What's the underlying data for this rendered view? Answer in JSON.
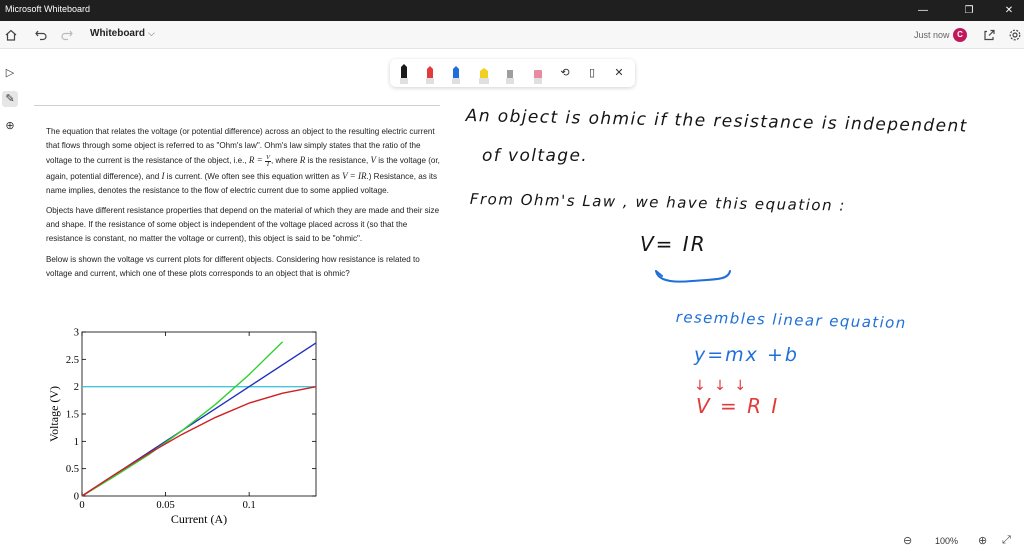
{
  "window": {
    "title": "Microsoft Whiteboard",
    "minimize": "—",
    "restore": "❐",
    "close": "✕"
  },
  "header": {
    "home_icon": "home-icon",
    "undo_icon": "undo-icon",
    "redo_icon": "redo-icon",
    "board_title": "Whiteboard",
    "board_dropdown": "⌵",
    "save_status": "Just now",
    "avatar_initial": "C",
    "avatar_color": "#c2185b",
    "share_icon": "share-icon",
    "settings_icon": "gear-icon"
  },
  "left_rail": {
    "items": [
      {
        "icon": "select-arrow-icon",
        "glyph": "▷"
      },
      {
        "icon": "pen-icon",
        "glyph": "✎"
      },
      {
        "icon": "add-icon",
        "glyph": "⊕"
      }
    ]
  },
  "pen_toolbar": {
    "pens": [
      {
        "name": "black",
        "color": "#1a1a1a"
      },
      {
        "name": "red",
        "color": "#e23b3b"
      },
      {
        "name": "blue",
        "color": "#1e6fd9"
      },
      {
        "name": "yellow-highlighter",
        "color": "#f0d020"
      },
      {
        "name": "ruler",
        "color": "#9e9e9e"
      },
      {
        "name": "eraser",
        "color": "#e88aa0"
      }
    ],
    "lasso_glyph": "⟲",
    "ruler_glyph": "▯",
    "close_glyph": "✕"
  },
  "problem": {
    "p1_a": "The equation that relates the voltage (or potential difference) across an object to the resulting electric current that flows through some object is referred to as \"Ohm's law\". Ohm's law simply states that the ratio of the voltage to the current is the resistance of the object, i.e.,",
    "r_eq": "R =",
    "frac_num": "V",
    "frac_den": "I",
    "p1_b": ", where",
    "r_sym": "R",
    "p1_c": "is the resistance,",
    "v_sym": "V",
    "p1_d": "is the voltage (or, again, potential difference), and",
    "i_sym": "I",
    "p1_e": "is current. (We often see this equation written as",
    "vir": "V = IR",
    "p1_f": ".) Resistance, as its name implies, denotes the resistance to the flow of electric current due to some applied voltage.",
    "p2": "Objects have different resistance properties that depend on the material of which they are made and their size and shape. If the resistance of some object is independent of the voltage placed across it (so that the resistance is constant, no matter the voltage or current), this object is said to be \"ohmic\".",
    "p3": "Below is shown the voltage vs current plots for different objects. Considering how resistance is related to voltage and current, which one of these plots corresponds to an object that is ohmic?"
  },
  "chart_data": {
    "type": "line",
    "xlabel": "Current (A)",
    "ylabel": "Voltage (V)",
    "xlim": [
      0,
      0.14
    ],
    "ylim": [
      0,
      3
    ],
    "x_ticks": [
      "0",
      "0.05",
      "0.1"
    ],
    "x_tick_values": [
      0,
      0.05,
      0.1
    ],
    "y_ticks": [
      "0",
      "0.5",
      "1",
      "1.5",
      "2",
      "2.5",
      "3"
    ],
    "y_tick_values": [
      0,
      0.5,
      1,
      1.5,
      2,
      2.5,
      3
    ],
    "series": [
      {
        "color": "#40c8d8",
        "x": [
          0,
          0.14
        ],
        "y": [
          2,
          2
        ]
      },
      {
        "color": "#2030c0",
        "x": [
          0,
          0.14
        ],
        "y": [
          0,
          2.8
        ]
      },
      {
        "color": "#30d030",
        "x": [
          0,
          0.02,
          0.04,
          0.06,
          0.08,
          0.1,
          0.12
        ],
        "y": [
          0,
          0.37,
          0.76,
          1.2,
          1.68,
          2.22,
          2.82
        ]
      },
      {
        "color": "#d02020",
        "x": [
          0,
          0.02,
          0.04,
          0.06,
          0.08,
          0.1,
          0.12,
          0.14
        ],
        "y": [
          0,
          0.4,
          0.78,
          1.13,
          1.44,
          1.7,
          1.88,
          2.0
        ]
      }
    ]
  },
  "handwriting": {
    "line1": "An object is ohmic if the resistance is independent",
    "line2": "of voltage.",
    "line3": "From Ohm's Law , we have this equation :",
    "eq1": "V= IR",
    "resembles": "resembles linear equation",
    "eq2": "y=mx +b",
    "arrows": "↓    ↓ ↓",
    "eq3": "V = R I"
  },
  "bottom_bar": {
    "zoom_out": "⊖",
    "zoom_level": "100%",
    "zoom_in": "⊕",
    "fit_icon": "fit-screen-icon",
    "fit_glyph": "⤢"
  }
}
